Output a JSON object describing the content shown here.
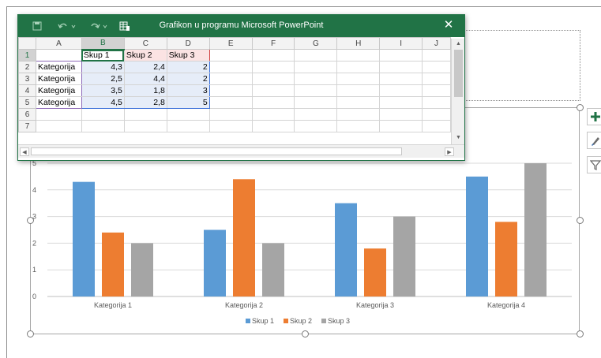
{
  "window": {
    "title": "Grafikon u programu Microsoft PowerPoint",
    "close_glyph": "✕",
    "toolbar_icons": [
      "save-icon",
      "undo-icon",
      "redo-icon",
      "edit-data-icon"
    ]
  },
  "sheet": {
    "columns": [
      "A",
      "B",
      "C",
      "D",
      "E",
      "F",
      "G",
      "H",
      "I",
      "J"
    ],
    "row_numbers": [
      "1",
      "2",
      "3",
      "4",
      "5",
      "6",
      "7"
    ],
    "header_row": [
      "",
      "Skup 1",
      "Skup 2",
      "Skup 3"
    ],
    "rows": [
      [
        "Kategorija",
        "4,3",
        "2,4",
        "2"
      ],
      [
        "Kategorija",
        "2,5",
        "4,4",
        "2"
      ],
      [
        "Kategorija",
        "3,5",
        "1,8",
        "3"
      ],
      [
        "Kategorija",
        "4,5",
        "2,8",
        "5"
      ]
    ]
  },
  "side_buttons": [
    "add-chart-element-icon",
    "chart-styles-icon",
    "chart-filter-icon"
  ],
  "colors": {
    "excel_green": "#217346",
    "series1": "#5B9BD5",
    "series2": "#ED7D31",
    "series3": "#A5A5A5"
  },
  "chart_data": {
    "type": "bar",
    "categories": [
      "Kategorija 1",
      "Kategorija 2",
      "Kategorija 3",
      "Kategorija 4"
    ],
    "series": [
      {
        "name": "Skup 1",
        "values": [
          4.3,
          2.5,
          3.5,
          4.5
        ],
        "color": "#5B9BD5"
      },
      {
        "name": "Skup 2",
        "values": [
          2.4,
          4.4,
          1.8,
          2.8
        ],
        "color": "#ED7D31"
      },
      {
        "name": "Skup 3",
        "values": [
          2,
          2,
          3,
          5
        ],
        "color": "#A5A5A5"
      }
    ],
    "y_ticks": [
      "0",
      "1",
      "2",
      "3",
      "4",
      "5"
    ],
    "ylim": [
      0,
      5
    ],
    "grid": true,
    "legend": "bottom"
  }
}
